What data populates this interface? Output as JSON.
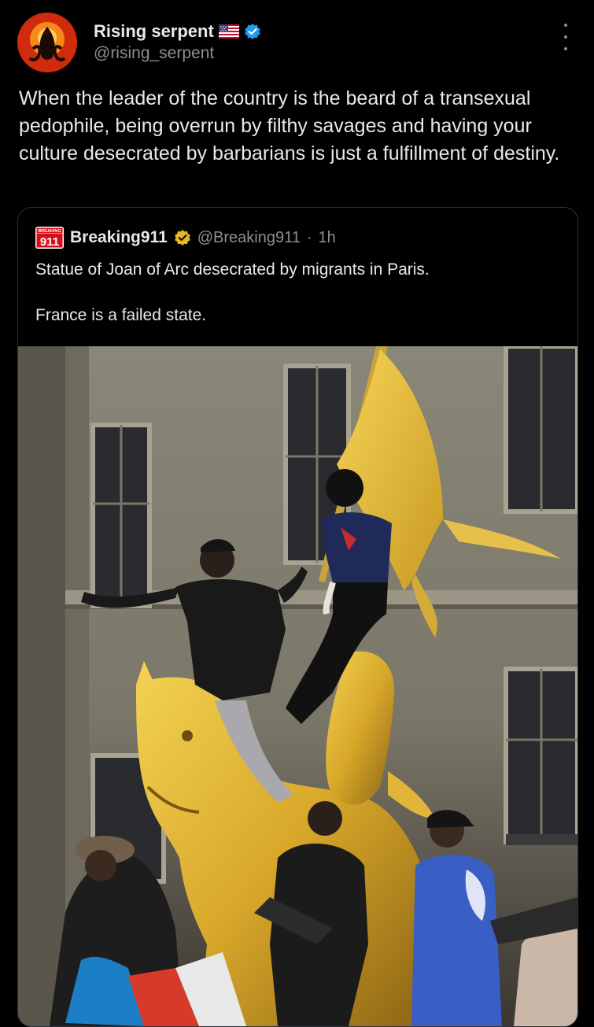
{
  "author": {
    "display_name": "Rising serpent",
    "handle": "@rising_serpent",
    "flag_icon": "us-flag-icon",
    "verified_icon": "verified-badge-icon",
    "verified_color": "#1d9bf0"
  },
  "tweet": {
    "text": "When the leader of the country is the beard of a transexual pedophile, being overrun by filthy savages and having your culture desecrated by barbarians is just a fulfillment of destiny."
  },
  "quoted": {
    "logo_top_text": "BREAKING",
    "logo_number": "911",
    "display_name": "Breaking911",
    "badge_icon": "gold-verified-badge-icon",
    "badge_color": "#e8b823",
    "handle": "@Breaking911",
    "separator": "·",
    "time": "1h",
    "text_line1": "Statue of Joan of Arc desecrated by migrants in Paris.",
    "text_line2": "France is a failed state.",
    "media_description_icon": "photo-statue-crowd"
  },
  "colors": {
    "background": "#000000",
    "text_primary": "#e7e9ea",
    "text_secondary": "#8b8f94",
    "border": "#2f3336"
  }
}
